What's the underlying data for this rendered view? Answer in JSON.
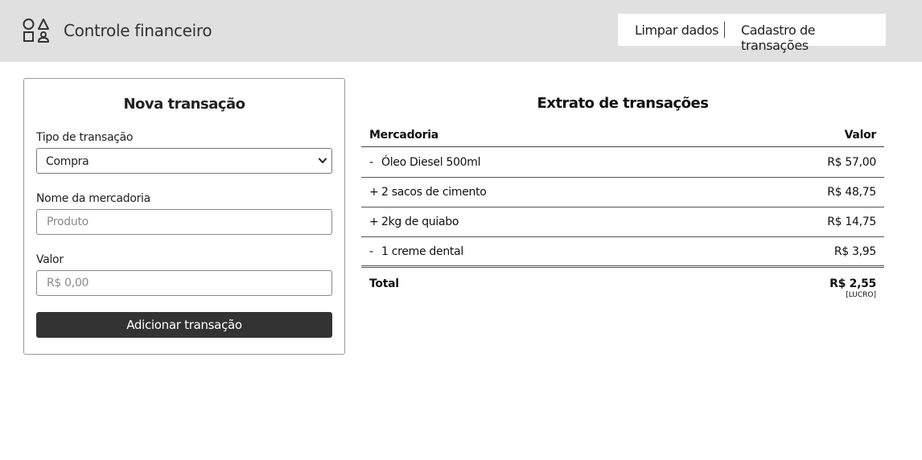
{
  "header": {
    "app_title": "Controle financeiro",
    "logo_icon": "shapes-icon",
    "nav": {
      "clear_label": "Limpar dados",
      "register_label": "Cadastro de transações"
    }
  },
  "form": {
    "title": "Nova transação",
    "type_label": "Tipo de transação",
    "type_value": "Compra",
    "name_label": "Nome da mercadoria",
    "name_placeholder": "Produto",
    "value_label": "Valor",
    "value_placeholder": "R$ 0,00",
    "submit_label": "Adicionar transação"
  },
  "statement": {
    "title": "Extrato de transações",
    "columns": [
      "Mercadoria",
      "Valor"
    ],
    "rows": [
      {
        "sign": "-",
        "name": "Óleo Diesel 500ml",
        "amount": "R$ 57,00"
      },
      {
        "sign": "+",
        "name": "2 sacos de cimento",
        "amount": "R$ 48,75"
      },
      {
        "sign": "+",
        "name": "2kg de quiabo",
        "amount": "R$ 14,75"
      },
      {
        "sign": "-",
        "name": "1 creme dental",
        "amount": "R$ 3,95"
      }
    ],
    "total_label": "Total",
    "total_value": "R$ 2,55",
    "total_status": "[LUCRO]"
  },
  "colors": {
    "header_bg": "#e0e0e0",
    "button_bg": "#333333"
  }
}
